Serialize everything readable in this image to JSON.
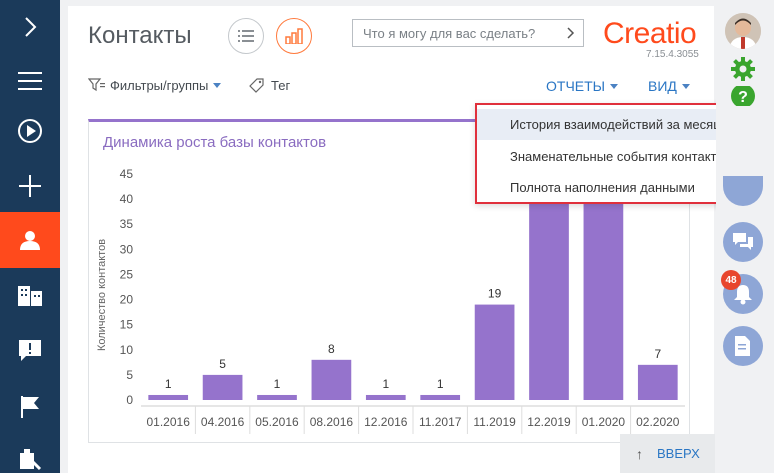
{
  "nav": {
    "items": [
      {
        "icon": "chevron-right-icon"
      },
      {
        "icon": "menu-icon"
      },
      {
        "icon": "play-icon"
      },
      {
        "icon": "plus-icon"
      },
      {
        "icon": "user-icon",
        "active": true
      },
      {
        "icon": "building-icon"
      },
      {
        "icon": "exclamation-bubble-icon"
      },
      {
        "icon": "flag-icon"
      },
      {
        "icon": "tools-icon"
      }
    ],
    "colors": {
      "bg": "#1b3a5a",
      "active": "#ff4a1c"
    }
  },
  "header": {
    "title": "Контакты",
    "search_placeholder": "Что я могу для вас сделать?",
    "logo": "Creatio",
    "version": "7.15.4.3055"
  },
  "toolbar": {
    "filters_label": "Фильтры/группы",
    "tag_label": "Тег",
    "reports_label": "ОТЧЕТЫ",
    "view_label": "ВИД"
  },
  "dropdown": {
    "items": [
      {
        "label": "История взаимодействий за месяц",
        "hovered": true
      },
      {
        "label": "Знаменательные события контакта"
      },
      {
        "label": "Полнота наполнения данными"
      }
    ]
  },
  "chart_data": {
    "type": "bar",
    "title": "Динамика роста базы контактов",
    "ylabel": "Количество контактов",
    "xlabel": "",
    "categories": [
      "01.2016",
      "04.2016",
      "05.2016",
      "08.2016",
      "12.2016",
      "11.2017",
      "11.2019",
      "12.2019",
      "01.2020",
      "02.2020"
    ],
    "values": [
      1,
      5,
      1,
      8,
      1,
      1,
      19,
      42,
      42,
      7
    ],
    "data_labels": [
      "1",
      "5",
      "1",
      "8",
      "1",
      "1",
      "19",
      "",
      "",
      "7"
    ],
    "yticks": [
      "0",
      "5",
      "10",
      "15",
      "20",
      "25",
      "30",
      "35",
      "40",
      "45"
    ],
    "ylim": [
      0,
      45
    ],
    "grid": false,
    "bar_color": "#9573cc"
  },
  "back_to_top": {
    "label": "ВВЕРХ"
  },
  "right_bar": {
    "notification_count": "48",
    "items": [
      "avatar",
      "gear-icon",
      "help-icon",
      "chat-icon",
      "bell-icon",
      "document-icon"
    ]
  }
}
